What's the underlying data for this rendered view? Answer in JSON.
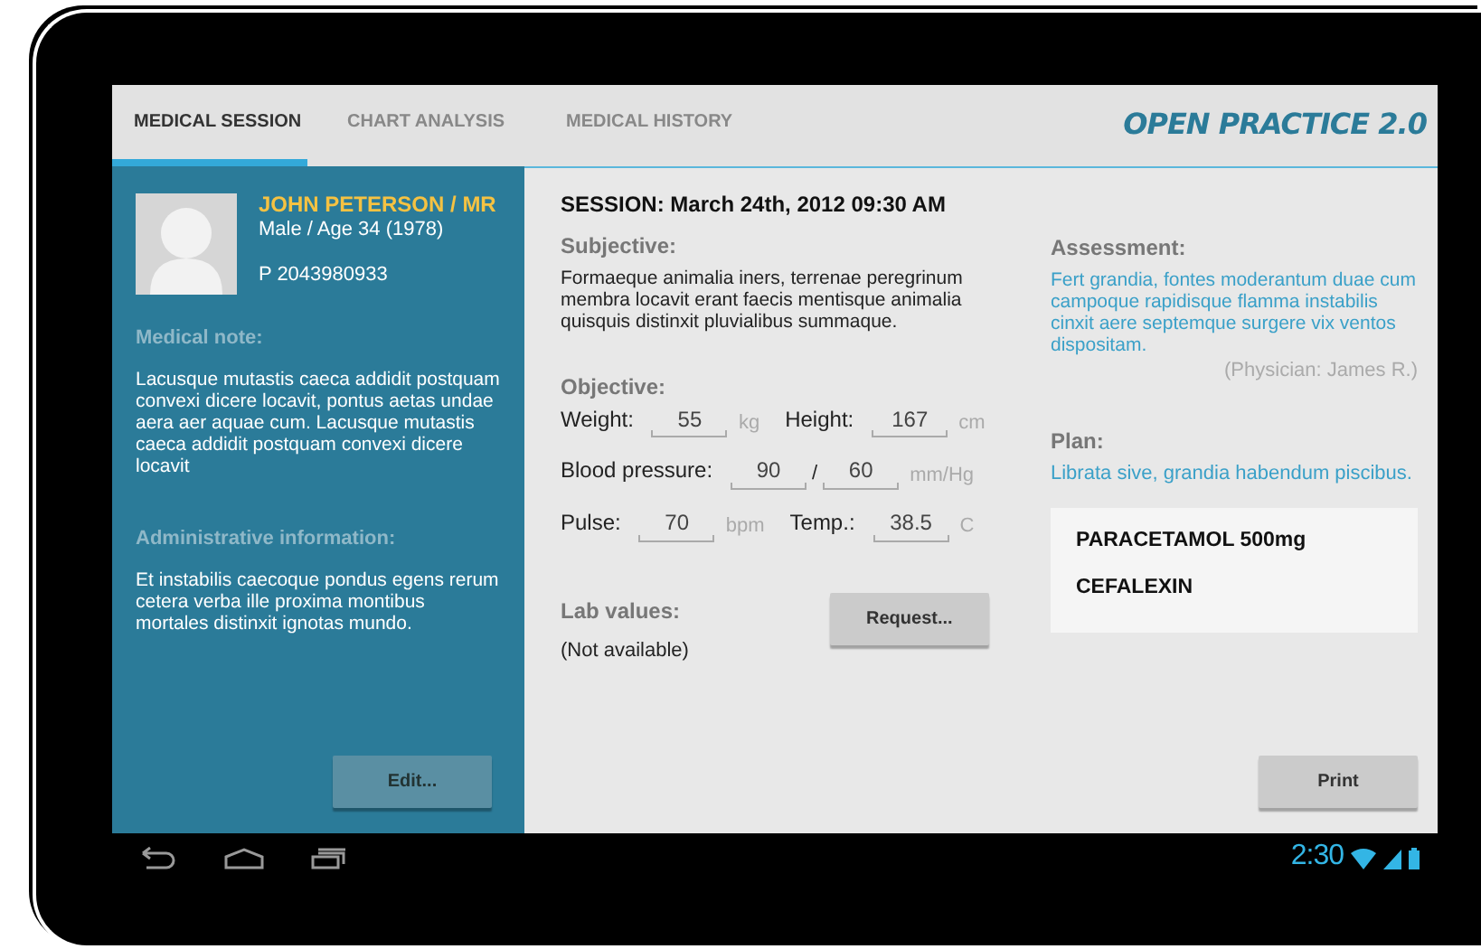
{
  "tabs": [
    {
      "label": "MEDICAL SESSION",
      "selected": true
    },
    {
      "label": "CHART ANALYSIS",
      "selected": false
    },
    {
      "label": "MEDICAL HISTORY",
      "selected": false
    }
  ],
  "app_title": "OPEN PRACTICE 2.0",
  "patient": {
    "name": "JOHN PETERSON / MR",
    "details": "Male / Age 34 (1978)",
    "phone": "P 2043980933"
  },
  "notes": [
    {
      "heading": "Medical note:",
      "text": "Lacusque mutastis caeca addidit postquam convexi dicere locavit, pontus aetas undae aera aer aquae cum. Lacusque mutastis caeca addidit postquam convexi dicere locavit"
    },
    {
      "heading": "Administrative information:",
      "text": "Et  instabilis caecoque pondus egens rerum cetera verba ille proxima montibus mortales distinxit ignotas mundo."
    }
  ],
  "edit_button": "Edit...",
  "session": {
    "title": "SESSION: March 24th, 2012 09:30 AM",
    "subjective": {
      "heading": "Subjective:",
      "text": "Formaeque animalia iners, terrenae peregrinum membra locavit erant faecis mentisque animalia quisquis distinxit pluvialibus summaque."
    },
    "objective": {
      "heading": "Objective:",
      "rows": [
        {
          "fields": [
            {
              "kind": "single",
              "label": "Weight:",
              "values": [
                "55"
              ],
              "unit": "kg"
            },
            {
              "kind": "single",
              "label": "Height:",
              "values": [
                "167"
              ],
              "unit": "cm"
            }
          ]
        },
        {
          "fields": [
            {
              "kind": "pair",
              "label": "Blood pressure:",
              "values": [
                "90",
                "60"
              ],
              "separator": "/",
              "unit": "mm/Hg"
            }
          ]
        },
        {
          "fields": [
            {
              "kind": "single",
              "label": "Pulse:",
              "values": [
                "70"
              ],
              "unit": "bpm"
            },
            {
              "kind": "single",
              "label": "Temp.:",
              "values": [
                "38.5"
              ],
              "unit": "C"
            }
          ]
        }
      ]
    },
    "lab": {
      "heading": "Lab values:",
      "value": "(Not available)",
      "button": "Request..."
    }
  },
  "assessment": {
    "heading": "Assessment:",
    "text": "Fert grandia, fontes moderantum duae cum campoque rapidisque flamma instabilis cinxit aere septemque surgere vix ventos dispositam.",
    "physician": "(Physician: James R.)"
  },
  "plan": {
    "heading": "Plan:",
    "text": "Librata sive, grandia habendum piscibus.",
    "prescriptions": [
      "PARACETAMOL 500mg",
      "CEFALEXIN"
    ]
  },
  "print_button": "Print",
  "status_bar": {
    "time": "2:30"
  }
}
